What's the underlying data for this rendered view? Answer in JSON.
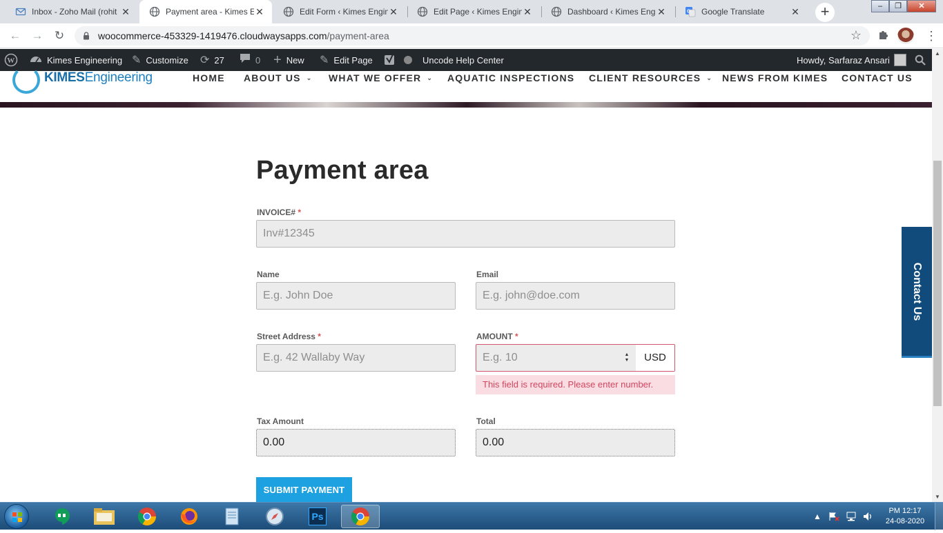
{
  "browser": {
    "tabs": [
      {
        "title": "Inbox - Zoho Mail (rohit",
        "icon": "mail-icon"
      },
      {
        "title": "Payment area - Kimes Er",
        "icon": "globe-icon",
        "active": true
      },
      {
        "title": "Edit Form ‹ Kimes Engine",
        "icon": "globe-icon"
      },
      {
        "title": "Edit Page ‹ Kimes Engine",
        "icon": "globe-icon"
      },
      {
        "title": "Dashboard ‹ Kimes Engin",
        "icon": "globe-icon"
      },
      {
        "title": "Google Translate",
        "icon": "translate-icon"
      }
    ],
    "close_glyph": "✕",
    "newtab_glyph": "+",
    "url_host": "woocommerce-453329-1419476.cloudwaysapps.com",
    "url_path": "/payment-area"
  },
  "adminbar": {
    "site_name": "Kimes Engineering",
    "customize": "Customize",
    "updates_count": "27",
    "comments_count": "0",
    "new_label": "New",
    "edit_page": "Edit Page",
    "help_center": "Uncode Help Center",
    "howdy": "Howdy, Sarfaraz Ansari"
  },
  "site": {
    "logo_bold": "KIMES",
    "logo_rest": "Engineering",
    "nav": [
      {
        "label": "HOME",
        "dropdown": false
      },
      {
        "label": "ABOUT US",
        "dropdown": true
      },
      {
        "label": "WHAT WE OFFER",
        "dropdown": true
      },
      {
        "label": "AQUATIC INSPECTIONS",
        "dropdown": false
      },
      {
        "label": "CLIENT RESOURCES",
        "dropdown": true
      },
      {
        "label": "NEWS FROM KIMES",
        "dropdown": false
      },
      {
        "label": "CONTACT US",
        "dropdown": false
      }
    ],
    "caret_glyph": "⌄",
    "contact_tab": "Contact Us"
  },
  "form": {
    "title": "Payment area",
    "invoice": {
      "label": "INVOICE#",
      "required": "*",
      "placeholder": "Inv#12345"
    },
    "name": {
      "label": "Name",
      "placeholder": "E.g. John Doe"
    },
    "email": {
      "label": "Email",
      "placeholder": "E.g. john@doe.com"
    },
    "street": {
      "label": "Street Address",
      "required": "*",
      "placeholder": "E.g. 42 Wallaby Way"
    },
    "amount": {
      "label": "AMOUNT",
      "required": "*",
      "placeholder": "E.g. 10",
      "currency": "USD",
      "error": "This field is required. Please enter number."
    },
    "tax": {
      "label": "Tax Amount",
      "value": "0.00"
    },
    "total": {
      "label": "Total",
      "value": "0.00"
    },
    "submit_label": "SUBMIT PAYMENT"
  },
  "taskbar": {
    "apps": [
      "hangouts-icon",
      "file-explorer-icon",
      "chrome-icon",
      "firefox-icon",
      "notepad-icon",
      "safari-icon",
      "photoshop-icon",
      "chrome-active-icon"
    ],
    "photoshop_label": "Ps",
    "time": "PM 12:17",
    "date": "24-08-2020"
  }
}
